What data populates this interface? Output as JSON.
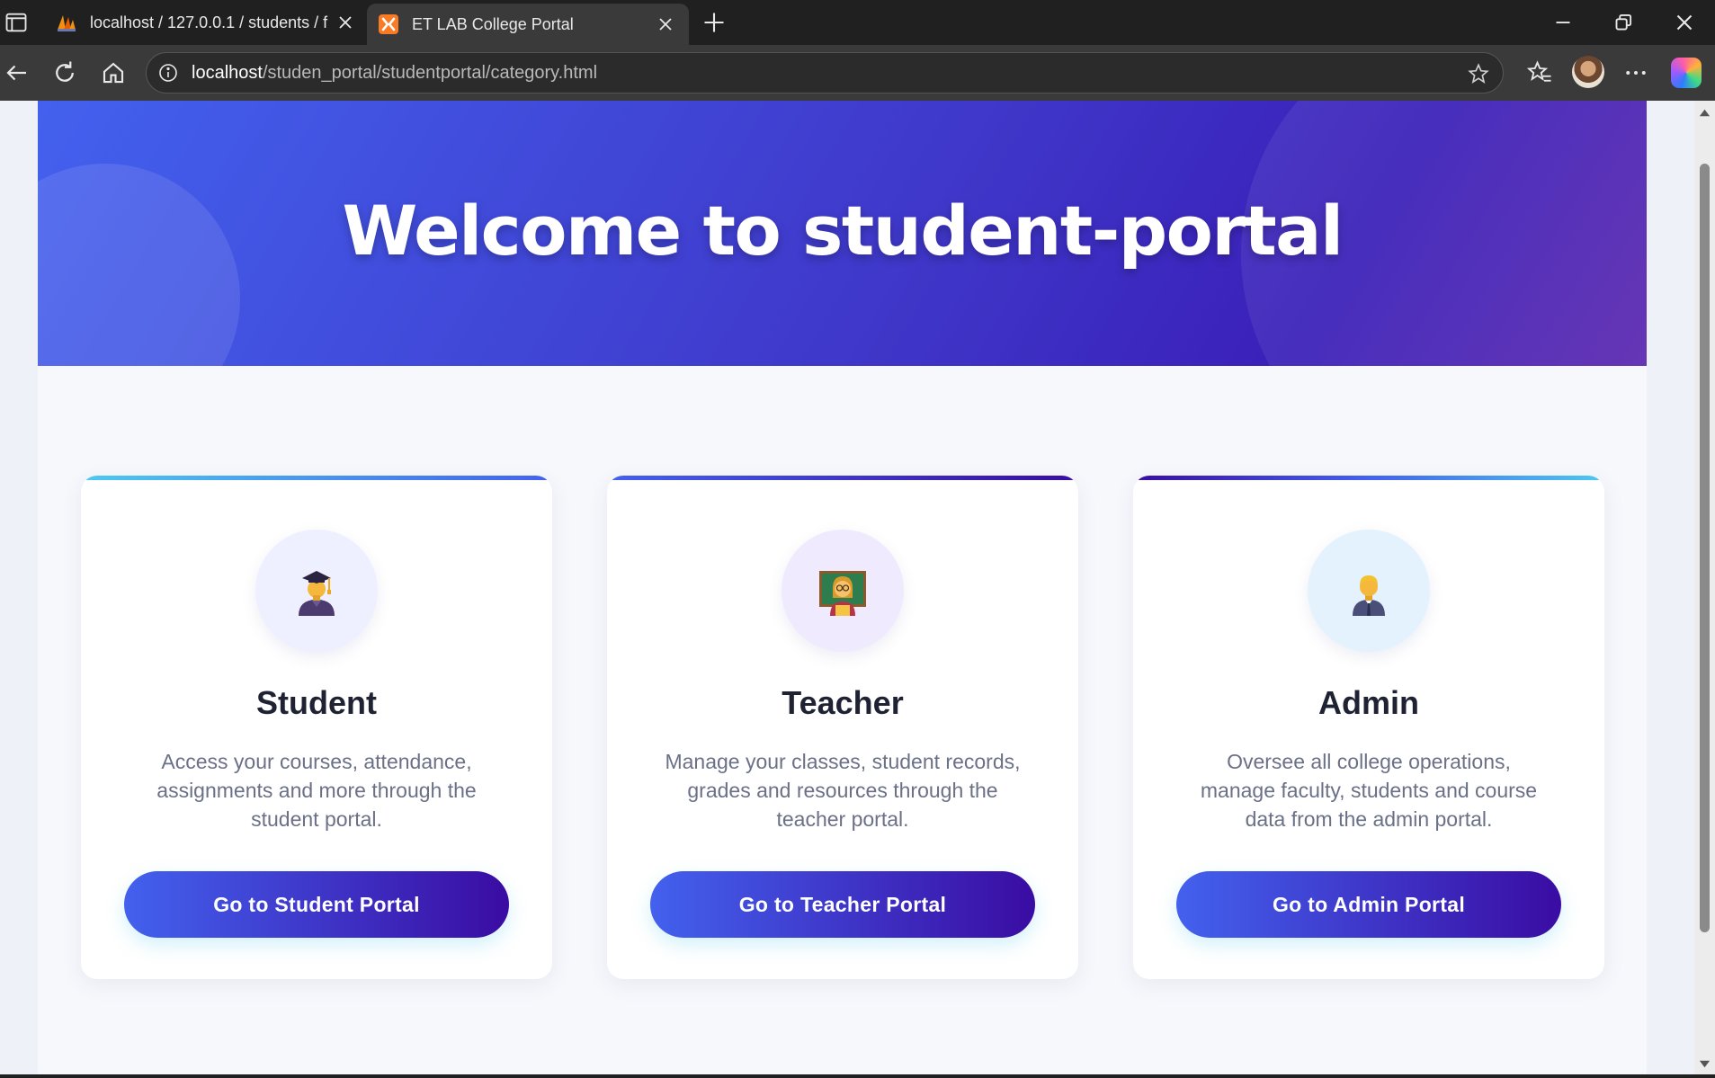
{
  "browser": {
    "tabs": [
      {
        "title": "localhost / 127.0.0.1 / students / f",
        "favicon": "phpmyadmin-icon",
        "active": false
      },
      {
        "title": "ET LAB College Portal",
        "favicon": "xampp-icon",
        "active": true
      }
    ],
    "address": {
      "host": "localhost",
      "path": "/studen_portal/studentportal/category.html"
    }
  },
  "hero": {
    "title": "Welcome to student-portal"
  },
  "cards": [
    {
      "title": "Student",
      "icon": "student-graduate-icon",
      "description": "Access your courses, attendance, assignments and more through the student portal.",
      "button": "Go to Student Portal"
    },
    {
      "title": "Teacher",
      "icon": "teacher-icon",
      "description": "Manage your classes, student records, grades and resources through the teacher portal.",
      "button": "Go to Teacher Portal"
    },
    {
      "title": "Admin",
      "icon": "admin-person-icon",
      "description": "Oversee all college operations, manage faculty, students and course data from the admin portal.",
      "button": "Go to Admin Portal"
    }
  ],
  "colors": {
    "primary": "#4361ee",
    "secondary": "#3a0ca3",
    "accent": "#4cc9f0"
  }
}
